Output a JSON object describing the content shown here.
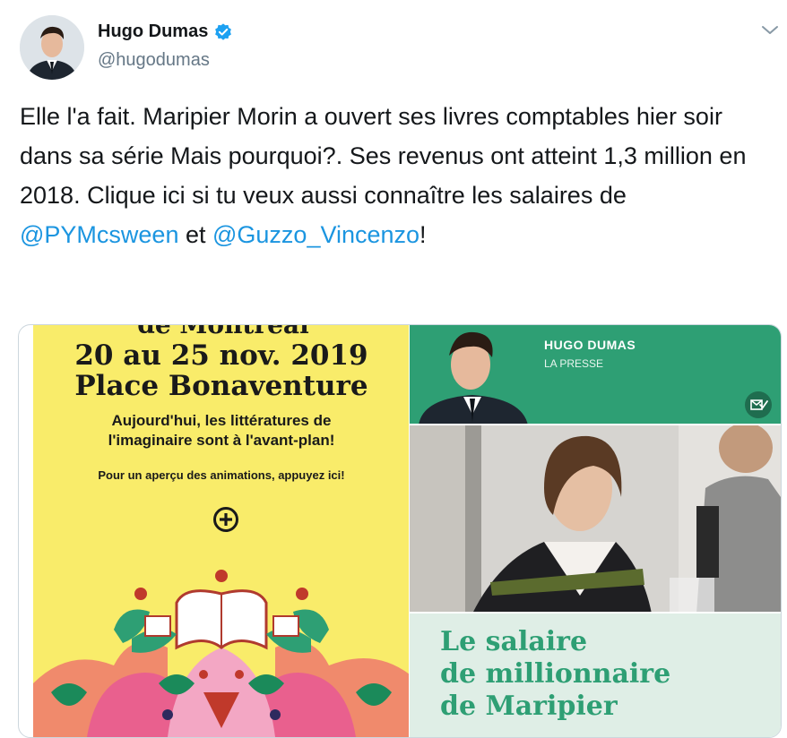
{
  "author": {
    "name": "Hugo Dumas",
    "handle": "@hugodumas",
    "verified_icon": "verified-badge-icon",
    "accent": "#1da1f2"
  },
  "menu_icon": "chevron-down-icon",
  "tweet": {
    "text_1": "Elle l'a fait. Maripier Morin a ouvert ses livres comptables hier soir dans sa série Mais pourquoi?. Ses revenus ont atteint 1,3 million en 2018. Clique ici si tu veux aussi connaître les salaires de ",
    "mention_1": "@PYMcsween",
    "text_2": " et ",
    "mention_2": "@Guzzo_Vincenzo",
    "text_3": "!",
    "mention_color": "#1b95e0"
  },
  "card": {
    "poster": {
      "header_partial": "de Montréal",
      "dates": "20 au 25 nov. 2019",
      "place": "Place Bonaventure",
      "tagline": "Aujourd'hui, les littératures de l'imaginaire sont à l'avant-plan!",
      "cta": "Pour un aperçu des animations, appuyez ici!",
      "plus_icon": "plus-circle-icon",
      "background": "#f9ec6a"
    },
    "ad_header": {
      "name": "HUGO DUMAS",
      "outlet": "LA PRESSE",
      "badge_icon": "mail-badge-icon",
      "background": "#2e9f74"
    },
    "ad_headline": {
      "line1": "Le salaire",
      "line2": "de millionnaire",
      "line3": "de Maripier",
      "color": "#2e9f74"
    }
  }
}
